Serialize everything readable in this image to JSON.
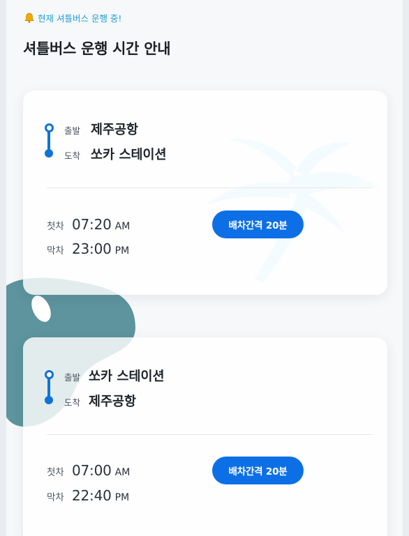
{
  "notice": {
    "text": "현재 셔틀버스 운행 중!",
    "icon": "bell-icon"
  },
  "page_title": "셔틀버스 운행 시간 안내",
  "schedules": [
    {
      "departure_label": "출발",
      "departure": "제주공항",
      "arrival_label": "도착",
      "arrival": "쏘카 스테이션",
      "first_label": "첫차",
      "first_time": "07:20",
      "first_ampm": "AM",
      "last_label": "막차",
      "last_time": "23:00",
      "last_ampm": "PM",
      "interval": "배차간격 20분"
    },
    {
      "departure_label": "출발",
      "departure": "쏘카 스테이션",
      "arrival_label": "도착",
      "arrival": "제주공항",
      "first_label": "첫차",
      "first_time": "07:00",
      "first_ampm": "AM",
      "last_label": "막차",
      "last_time": "22:40",
      "last_ampm": "PM",
      "interval": "배차간격 20분"
    }
  ],
  "colors": {
    "accent": "#0d6fe6",
    "notice": "#1e9fdc",
    "route_line": "#0f73d9",
    "palm": "#bfe9f7",
    "blob": "#5d949d"
  }
}
